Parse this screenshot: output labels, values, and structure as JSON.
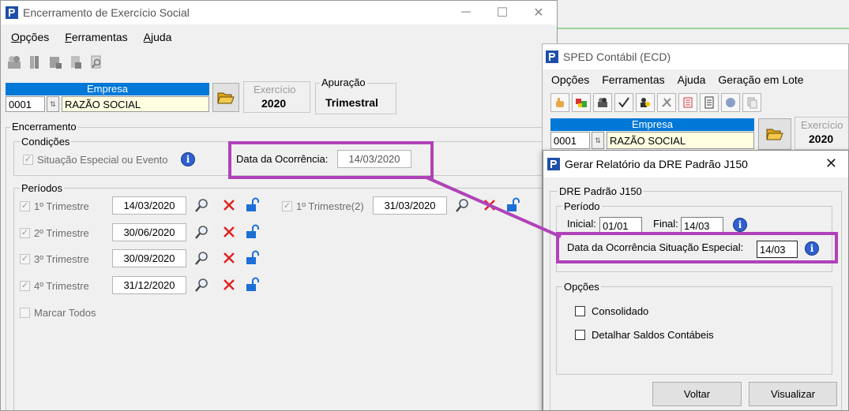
{
  "win1": {
    "title": "Encerramento de Exercício Social",
    "menu": {
      "opcoes_pre": "",
      "opcoes_u": "O",
      "opcoes_rest": "pções",
      "ferr_u": "F",
      "ferr_rest": "erramentas",
      "ajuda_u": "A",
      "ajuda_rest": "juda"
    },
    "empresa_label": "Empresa",
    "empresa_code": "0001",
    "empresa_name": "RAZÃO SOCIAL",
    "exercicio_label": "Exercício",
    "exercicio_value": "2020",
    "apuracao_label": "Apuração",
    "apuracao_value": "Trimestral",
    "encerramento_label": "Encerramento",
    "condicoes_label": "Condições",
    "situacao_label": "Situação Especial ou Evento",
    "data_ocorrencia_label": "Data da Ocorrência:",
    "data_ocorrencia_value": "14/03/2020",
    "periodos_label": "Períodos",
    "periodos": [
      {
        "label": "1º Trimestre",
        "date": "14/03/2020"
      },
      {
        "label": "2º Trimestre",
        "date": "30/06/2020"
      },
      {
        "label": "3º Trimestre",
        "date": "30/09/2020"
      },
      {
        "label": "4º Trimestre",
        "date": "31/12/2020"
      }
    ],
    "periodo_extra": {
      "label": "1º Trimestre(2)",
      "date": "31/03/2020"
    },
    "marcar_todos": "Marcar Todos"
  },
  "win2": {
    "title": "SPED Contábil (ECD)",
    "menu": [
      "Opções",
      "Ferramentas",
      "Ajuda",
      "Geração em Lote"
    ],
    "empresa_label": "Empresa",
    "empresa_code": "0001",
    "empresa_name": "RAZÃO SOCIAL",
    "exercicio_label": "Exercício",
    "exercicio_value": "2020"
  },
  "dialog": {
    "title": "Gerar Relatório da DRE Padrão J150",
    "group_label": "DRE Padrão J150",
    "periodo_label": "Período",
    "inicial_label": "Inicial:",
    "inicial_value": "01/01",
    "final_label": "Final:",
    "final_value": "14/03",
    "data_ocorrencia_label": "Data da Ocorrência Situação Especial:",
    "data_ocorrencia_value": "14/03",
    "opcoes_label": "Opções",
    "consolidado_label": "Consolidado",
    "detalhar_label": "Detalhar Saldos Contábeis",
    "voltar_label": "Voltar",
    "visualizar_label": "Visualizar"
  },
  "colors": {
    "accent": "#0078d7",
    "highlight": "#b042b8",
    "info": "#2f5fd0",
    "delete": "#e02020"
  }
}
